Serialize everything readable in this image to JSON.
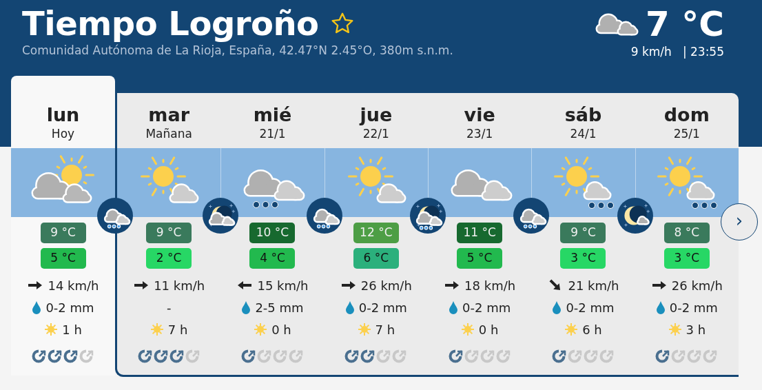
{
  "header": {
    "title": "Tiempo Logroño",
    "favorite": false,
    "subtitle": "Comunidad Autónoma de La Rioja, España, 42.47°N 2.45°O, 380m s.n.m.",
    "current": {
      "temperature": "7 °C",
      "wind": "9 km/h",
      "time": "| 23:55"
    }
  },
  "days": [
    {
      "name": "lun",
      "date": "Hoy",
      "selected": true,
      "sky": {
        "kind": "sun-cloud"
      },
      "night": {
        "kind": "cloud-rain"
      },
      "max": {
        "text": "9 °C",
        "color": "#3a7a5c"
      },
      "min": {
        "text": "5 °C",
        "color": "#22b94e"
      },
      "wind": "14 km/h",
      "wind_arrow": {
        "kind": "east"
      },
      "drop": true,
      "rain": "0-2 mm",
      "sun": "1 h",
      "indicators": [
        {
          "on": true
        },
        {
          "on": true
        },
        {
          "on": true
        },
        {
          "on": false
        }
      ]
    },
    {
      "name": "mar",
      "date": "Mañana",
      "selected": false,
      "sky": {
        "kind": "sun-small-cloud"
      },
      "night": {
        "kind": "moon-cloud"
      },
      "max": {
        "text": "9 °C",
        "color": "#3a7a5c"
      },
      "min": {
        "text": "2 °C",
        "color": "#27d765"
      },
      "wind": "11 km/h",
      "wind_arrow": {
        "kind": "east"
      },
      "drop": false,
      "rain": "-",
      "sun": "7 h",
      "indicators": [
        {
          "on": true
        },
        {
          "on": true
        },
        {
          "on": true
        },
        {
          "on": false
        }
      ]
    },
    {
      "name": "mié",
      "date": "21/1",
      "selected": false,
      "sky": {
        "kind": "cloud-rain"
      },
      "night": {
        "kind": "cloud-rain"
      },
      "max": {
        "text": "10 °C",
        "color": "#17692f"
      },
      "min": {
        "text": "4 °C",
        "color": "#22b94e"
      },
      "wind": "15 km/h",
      "wind_arrow": {
        "kind": "west"
      },
      "drop": true,
      "rain": "2-5 mm",
      "sun": "0 h",
      "indicators": [
        {
          "on": true
        },
        {
          "on": false
        },
        {
          "on": false
        },
        {
          "on": false
        }
      ]
    },
    {
      "name": "jue",
      "date": "22/1",
      "selected": false,
      "sky": {
        "kind": "sun-small-cloud"
      },
      "night": {
        "kind": "moon-cloud-rain"
      },
      "max": {
        "text": "12 °C",
        "color": "#4d9e45"
      },
      "min": {
        "text": "6 °C",
        "color": "#2bb07c"
      },
      "wind": "26 km/h",
      "wind_arrow": {
        "kind": "east"
      },
      "drop": true,
      "rain": "0-2 mm",
      "sun": "7 h",
      "indicators": [
        {
          "on": true
        },
        {
          "on": true
        },
        {
          "on": false
        },
        {
          "on": false
        }
      ]
    },
    {
      "name": "vie",
      "date": "23/1",
      "selected": false,
      "sky": {
        "kind": "cloud"
      },
      "night": {
        "kind": "cloud-rain"
      },
      "max": {
        "text": "11 °C",
        "color": "#17692f"
      },
      "min": {
        "text": "5 °C",
        "color": "#22b94e"
      },
      "wind": "18 km/h",
      "wind_arrow": {
        "kind": "east"
      },
      "drop": true,
      "rain": "0-2 mm",
      "sun": "0 h",
      "indicators": [
        {
          "on": true
        },
        {
          "on": false
        },
        {
          "on": false
        },
        {
          "on": false
        }
      ]
    },
    {
      "name": "sáb",
      "date": "24/1",
      "selected": false,
      "sky": {
        "kind": "sun-rain"
      },
      "night": {
        "kind": "moon"
      },
      "max": {
        "text": "9 °C",
        "color": "#3a7a5c"
      },
      "min": {
        "text": "3 °C",
        "color": "#27d765"
      },
      "wind": "21 km/h",
      "wind_arrow": {
        "kind": "southeast"
      },
      "drop": true,
      "rain": "0-2 mm",
      "sun": "6 h",
      "indicators": [
        {
          "on": true
        },
        {
          "on": false
        },
        {
          "on": false
        },
        {
          "on": false
        }
      ]
    },
    {
      "name": "dom",
      "date": "25/1",
      "selected": false,
      "sky": {
        "kind": "sun-rain"
      },
      "max": {
        "text": "8 °C",
        "color": "#3a7a5c"
      },
      "min": {
        "text": "3 °C",
        "color": "#27d765"
      },
      "wind": "26 km/h",
      "wind_arrow": {
        "kind": "east"
      },
      "drop": true,
      "rain": "0-2 mm",
      "sun": "3 h",
      "indicators": [
        {
          "on": true
        },
        {
          "on": false
        },
        {
          "on": false
        },
        {
          "on": false
        }
      ]
    }
  ],
  "next_button": "›"
}
